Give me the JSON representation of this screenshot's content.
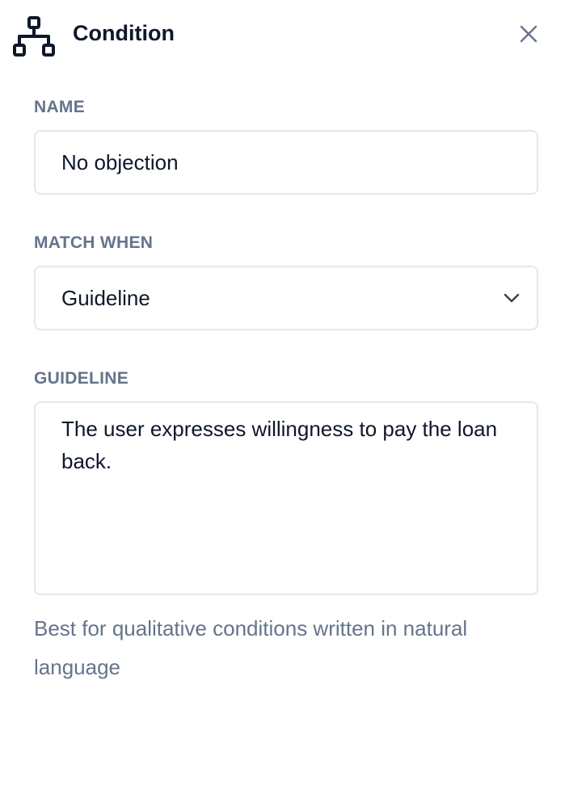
{
  "header": {
    "title": "Condition",
    "icon": "hierarchy-icon",
    "close_icon": "close-icon"
  },
  "fields": {
    "name": {
      "label": "NAME",
      "value": "No objection"
    },
    "match_when": {
      "label": "MATCH WHEN",
      "selected": "Guideline",
      "icon": "chevron-down-icon"
    },
    "guideline": {
      "label": "GUIDELINE",
      "value": "The user expresses willingness to pay the loan back."
    }
  },
  "help_text": "Best for qualitative conditions written in natural language",
  "colors": {
    "title": "#0f172a",
    "label": "#64748b",
    "border": "#e2e8f0",
    "icon": "#0f172a"
  }
}
